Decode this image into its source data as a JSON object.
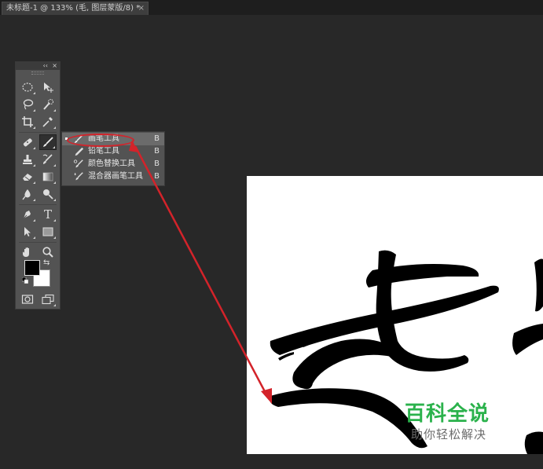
{
  "document_tab": {
    "title": "未标题-1 @ 133% (毛, 图层蒙版/8) *",
    "close_symbol": "×"
  },
  "tools_panel": {
    "collapse_symbol": "‹‹",
    "close_symbol": "×",
    "tools": [
      {
        "name": "marquee",
        "icon": "elliptical-marquee-icon"
      },
      {
        "name": "move",
        "icon": "move-icon"
      },
      {
        "name": "lasso",
        "icon": "lasso-icon"
      },
      {
        "name": "quick-selection",
        "icon": "quick-selection-icon"
      },
      {
        "name": "crop",
        "icon": "crop-icon"
      },
      {
        "name": "eyedropper",
        "icon": "eyedropper-icon"
      },
      {
        "name": "healing",
        "icon": "healing-brush-icon"
      },
      {
        "name": "brush",
        "icon": "brush-icon",
        "active": true
      },
      {
        "name": "clone-stamp",
        "icon": "clone-stamp-icon"
      },
      {
        "name": "history-brush",
        "icon": "history-brush-icon"
      },
      {
        "name": "eraser",
        "icon": "eraser-icon"
      },
      {
        "name": "gradient",
        "icon": "gradient-icon"
      },
      {
        "name": "blur",
        "icon": "blur-icon"
      },
      {
        "name": "dodge",
        "icon": "dodge-icon"
      },
      {
        "name": "pen",
        "icon": "pen-icon"
      },
      {
        "name": "type",
        "icon": "type-icon"
      },
      {
        "name": "path-selection",
        "icon": "path-selection-icon"
      },
      {
        "name": "rectangle",
        "icon": "rectangle-icon"
      },
      {
        "name": "hand",
        "icon": "hand-icon"
      },
      {
        "name": "zoom",
        "icon": "zoom-icon"
      }
    ],
    "type_glyph": "T",
    "foreground_color": "#000000",
    "background_color": "#ffffff"
  },
  "flyout_menu": {
    "items": [
      {
        "label": "画笔工具",
        "shortcut": "B",
        "selected": true,
        "icon": "brush-icon"
      },
      {
        "label": "铅笔工具",
        "shortcut": "B",
        "selected": false,
        "icon": "pencil-icon"
      },
      {
        "label": "颜色替换工具",
        "shortcut": "B",
        "selected": false,
        "icon": "color-replacement-icon"
      },
      {
        "label": "混合器画笔工具",
        "shortcut": "B",
        "selected": false,
        "icon": "mixer-brush-icon"
      }
    ]
  },
  "watermark": {
    "title": "百科全说",
    "subtitle": "助你轻松解决"
  },
  "colors": {
    "annotation_red": "#d3232a",
    "watermark_green": "#2bb24c",
    "app_background": "#282828",
    "panel": "#535353"
  }
}
